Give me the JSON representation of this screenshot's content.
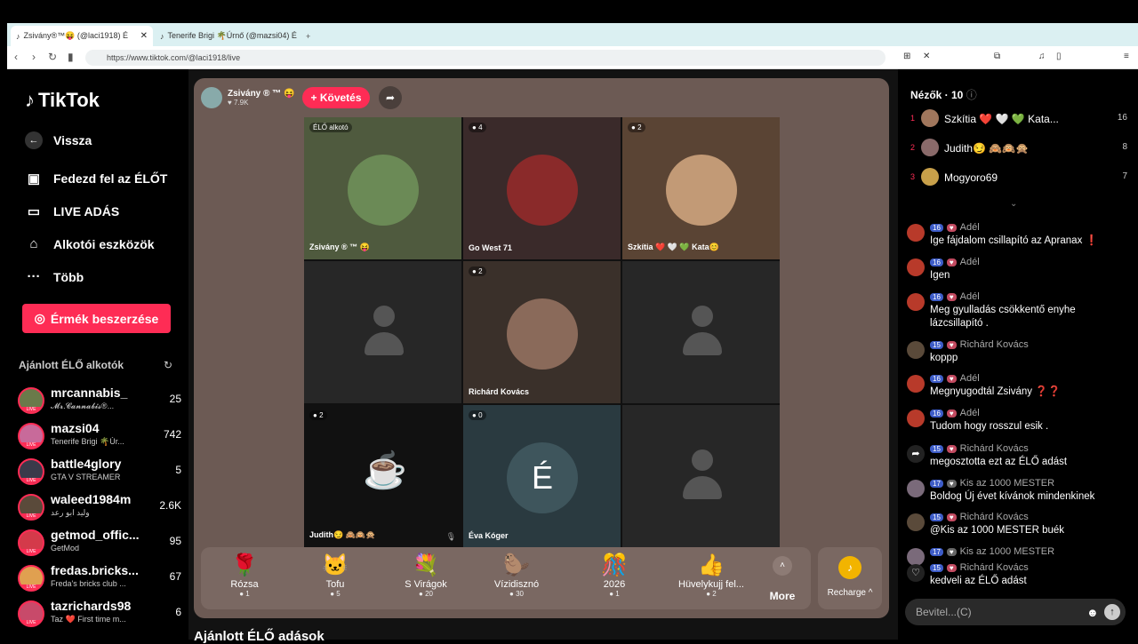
{
  "browser": {
    "tabs": [
      {
        "title": "Zsivány®™😝 (@laci1918) É",
        "active": true
      },
      {
        "title": "Tenerife Brigi 🌴Úrnő (@mazsi04) É",
        "active": false
      }
    ],
    "url": "https://www.tiktok.com/@laci1918/live"
  },
  "sidebar": {
    "logo": "TikTok",
    "back": "Vissza",
    "items": [
      {
        "label": "Fedezd fel az ÉLŐT",
        "icon": "live-discover-icon"
      },
      {
        "label": "LIVE ADÁS",
        "icon": "camera-icon"
      },
      {
        "label": "Alkotói eszközök",
        "icon": "creator-tools-icon"
      },
      {
        "label": "Több",
        "icon": "more-icon"
      }
    ],
    "coins_button": "Érmék beszerzése",
    "recommended_title": "Ajánlott ÉLŐ alkotók",
    "creators": [
      {
        "name": "mrcannabis_",
        "sub": "𝓜𝓻.𝓒𝓪𝓷𝓷𝓪𝓫𝓲𝓼®...",
        "count": "25"
      },
      {
        "name": "mazsi04",
        "sub": "Tenerife Brigi 🌴Úr...",
        "count": "742"
      },
      {
        "name": "battle4glory",
        "sub": "GTA V STREAMER",
        "count": "5"
      },
      {
        "name": "waleed1984m",
        "sub": "وليد ابو رعد",
        "count": "2.6K"
      },
      {
        "name": "getmod_offic...",
        "sub": "GetMod",
        "count": "95"
      },
      {
        "name": "fredas.bricks...",
        "sub": "Freda's bricks club ...",
        "count": "67"
      },
      {
        "name": "tazrichards98",
        "sub": "Taz ❤️ First time m...",
        "count": "6"
      }
    ],
    "live_badge": "LIVE"
  },
  "stage": {
    "host_name": "Zsivány ® ™ 😝",
    "host_likes": "♥ 7.9K",
    "follow": "+ Követés",
    "cells": [
      {
        "badge": "ÉLŐ alkotó",
        "name": "Zsivány ® ™ 😝",
        "type": "photo",
        "color": "#6b8a56"
      },
      {
        "badge": "4",
        "name": "Go West 71",
        "type": "photo",
        "color": "#8a2a2a"
      },
      {
        "badge": "2",
        "name": "Szkítia ❤️ 🤍 💚 Kata😊",
        "type": "photo",
        "color": "#c29a76"
      },
      {
        "badge": "",
        "name": "",
        "type": "ghost",
        "color": "#272727"
      },
      {
        "badge": "2",
        "name": "Richárd Kovács",
        "type": "photo",
        "color": "#8a6a5a"
      },
      {
        "badge": "",
        "name": "",
        "type": "ghost",
        "color": "#272727"
      },
      {
        "badge": "2",
        "name": "Judith😏 🙈🙉🙊",
        "type": "cup",
        "color": "#111111"
      },
      {
        "badge": "0",
        "name": "Éva Kóger",
        "type": "letter",
        "letter": "É",
        "color": "#2a3a40"
      },
      {
        "badge": "",
        "name": "",
        "type": "ghost",
        "color": "#272727"
      }
    ],
    "gifts": [
      {
        "icon": "🌹",
        "name": "Rózsa",
        "price": "1"
      },
      {
        "icon": "🐱",
        "name": "Tofu",
        "price": "5"
      },
      {
        "icon": "💐",
        "name": "S Virágok",
        "price": "20"
      },
      {
        "icon": "🦫",
        "name": "Vízidisznó",
        "price": "30"
      },
      {
        "icon": "🎊",
        "name": "2026",
        "price": "1"
      },
      {
        "icon": "👍",
        "name": "Hüvelykujj fel...",
        "price": "2"
      }
    ],
    "more": "More",
    "recharge": "Recharge ^",
    "recommended_live": "Ajánlott ÉLŐ adások"
  },
  "chat": {
    "viewers_title": "Nézők · 10",
    "viewers": [
      {
        "rank": "1",
        "name": "Szkítia ❤️ 🤍 💚 Kata...",
        "score": "16"
      },
      {
        "rank": "2",
        "name": "Judith😏 🙈🙉🙊",
        "score": "8"
      },
      {
        "rank": "3",
        "name": "Mogyoro69",
        "score": "7"
      }
    ],
    "messages": [
      {
        "level": "16",
        "user": "Adél",
        "text": "Ige fájdalom csillapító az Apranax ❗"
      },
      {
        "level": "16",
        "user": "Adél",
        "text": "Igen"
      },
      {
        "level": "16",
        "user": "Adél",
        "text": "Meg gyulladás csökkentő enyhe lázcsillapító ."
      },
      {
        "level": "15",
        "user": "Richárd Kovács",
        "text": "koppp"
      },
      {
        "level": "16",
        "user": "Adél",
        "text": "Megnyugodtál Zsivány ❓❓"
      },
      {
        "level": "16",
        "user": "Adél",
        "text": "Tudom hogy rosszul esik ."
      },
      {
        "level": "15",
        "user": "Richárd Kovács",
        "text": "megosztotta ezt az ÉLŐ adást"
      },
      {
        "level": "17",
        "user": "Kis az 1000 MESTER",
        "text": "Boldog Új évet kívánok mindenkinek"
      },
      {
        "level": "15",
        "user": "Richárd Kovács",
        "text": "@Kis az 1000 MESTER buék"
      },
      {
        "level": "17",
        "user": "Kis az 1000 MESTER",
        "text": ""
      },
      {
        "level": "15",
        "user": "Richárd Kovács",
        "text": "kedveli az ÉLŐ adást"
      }
    ],
    "input_placeholder": "Bevitel...(C)"
  },
  "colors": {
    "accent": "#fe2c55",
    "stage": "#6c5a54"
  }
}
